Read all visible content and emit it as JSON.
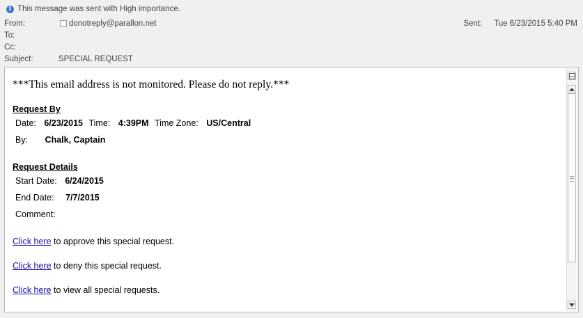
{
  "header": {
    "importance_text": "This message was sent with High importance.",
    "from_label": "From:",
    "from_value": "donotreply@parallon.net",
    "to_label": "To:",
    "cc_label": "Cc:",
    "subject_label": "Subject:",
    "subject_value": "SPECIAL REQUEST",
    "sent_label": "Sent:",
    "sent_value": "Tue 6/23/2015 5:40 PM"
  },
  "body": {
    "notice": "***This email address is not monitored. Please do not reply.***",
    "request_by": {
      "title": "Request By",
      "date_label": "Date:",
      "date_value": "6/23/2015",
      "time_label": "Time:",
      "time_value": "4:39PM",
      "tz_label": "Time Zone:",
      "tz_value": "US/Central",
      "by_label": "By:",
      "by_value": "Chalk, Captain"
    },
    "request_details": {
      "title": "Request Details",
      "start_label": "Start Date:",
      "start_value": "6/24/2015",
      "end_label": "End Date:",
      "end_value": "7/7/2015",
      "comment_label": "Comment:"
    },
    "links": [
      {
        "link_text": "Click here",
        "rest": " to approve this special request."
      },
      {
        "link_text": "Click here",
        "rest": " to deny this special request."
      },
      {
        "link_text": "Click here",
        "rest": " to view all special requests."
      }
    ]
  },
  "icons": {
    "info": "info-icon",
    "contact": "contact-checkbox-icon",
    "scroll_up": "scroll-up-icon",
    "scroll_down": "scroll-down-icon",
    "split": "split-view-icon"
  },
  "colors": {
    "link": "#1a0dab",
    "info_icon": "#3a78c8"
  }
}
